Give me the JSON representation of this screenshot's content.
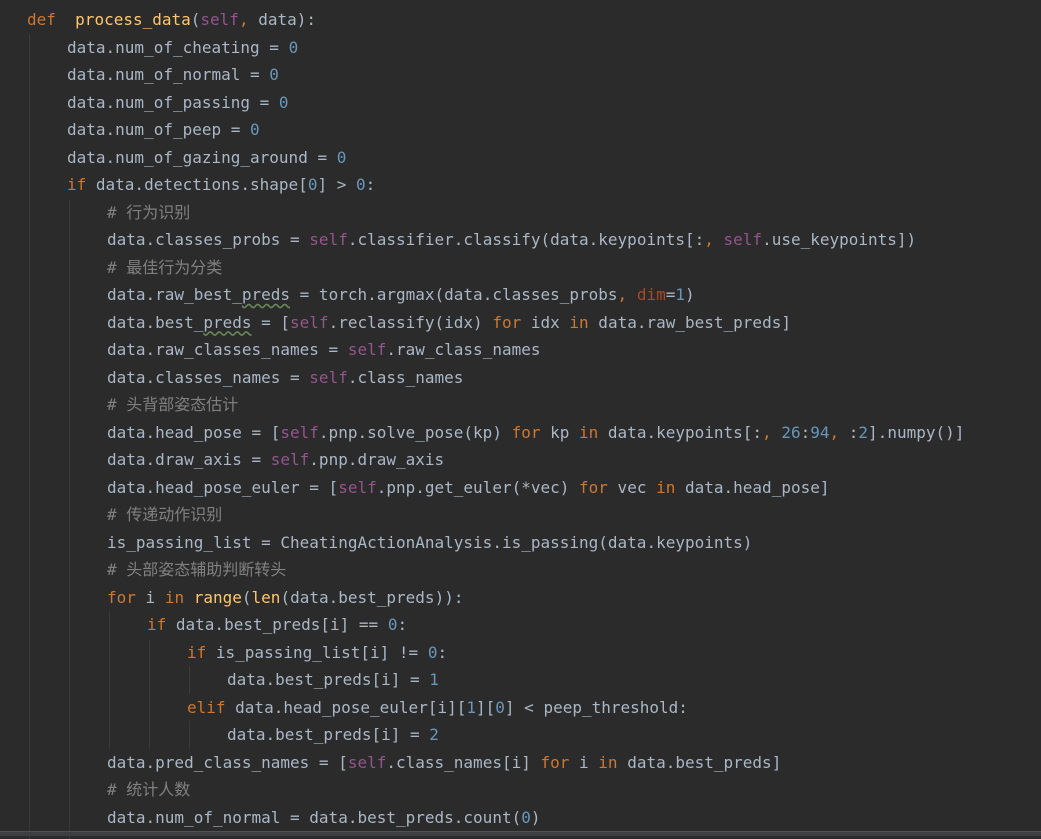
{
  "colors": {
    "background": "#2b2b2b",
    "default": "#a9b7c6",
    "keyword": "#cc7832",
    "function_name": "#ffc66d",
    "self": "#94558d",
    "number": "#6897bb",
    "comment": "#808080",
    "named_arg": "#aa4926"
  },
  "code_lines": [
    {
      "indent": 0,
      "tokens": [
        [
          "kw",
          "def"
        ],
        [
          "",
          "  "
        ],
        [
          "fn",
          "process_data"
        ],
        [
          "",
          "("
        ],
        [
          "self",
          "self"
        ],
        [
          "kw",
          ","
        ],
        [
          "",
          " data):"
        ]
      ]
    },
    {
      "indent": 1,
      "tokens": [
        [
          "",
          "data.num_of_cheating = "
        ],
        [
          "num",
          "0"
        ]
      ]
    },
    {
      "indent": 1,
      "tokens": [
        [
          "",
          "data.num_of_normal = "
        ],
        [
          "num",
          "0"
        ]
      ]
    },
    {
      "indent": 1,
      "tokens": [
        [
          "",
          "data.num_of_passing = "
        ],
        [
          "num",
          "0"
        ]
      ]
    },
    {
      "indent": 1,
      "tokens": [
        [
          "",
          "data.num_of_peep = "
        ],
        [
          "num",
          "0"
        ]
      ]
    },
    {
      "indent": 1,
      "tokens": [
        [
          "",
          "data.num_of_gazing_around = "
        ],
        [
          "num",
          "0"
        ]
      ]
    },
    {
      "indent": 1,
      "tokens": [
        [
          "kw",
          "if"
        ],
        [
          "",
          " data.detections.shape["
        ],
        [
          "num",
          "0"
        ],
        [
          "",
          "] > "
        ],
        [
          "num",
          "0"
        ],
        [
          "",
          ":"
        ]
      ]
    },
    {
      "indent": 2,
      "tokens": [
        [
          "cm",
          "# 行为识别"
        ]
      ]
    },
    {
      "indent": 2,
      "tokens": [
        [
          "",
          "data.classes_probs = "
        ],
        [
          "self",
          "self"
        ],
        [
          "",
          ".classifier.classify(data.keypoints[:"
        ],
        [
          "kw",
          ","
        ],
        [
          " ",
          ""
        ],
        [
          "self",
          " self"
        ],
        [
          "",
          ".use_keypoints])"
        ]
      ]
    },
    {
      "indent": 2,
      "tokens": [
        [
          "cm",
          "# 最佳行为分类"
        ]
      ]
    },
    {
      "indent": 2,
      "tokens": [
        [
          "",
          "data.raw_best_"
        ],
        [
          "typo",
          "preds"
        ],
        [
          "",
          " = torch.argmax(data.classes_probs"
        ],
        [
          "kw",
          ","
        ],
        [
          "named",
          " dim"
        ],
        [
          "",
          "="
        ],
        [
          "num",
          "1"
        ],
        [
          "",
          ")"
        ]
      ]
    },
    {
      "indent": 2,
      "tokens": [
        [
          "",
          "data.best_"
        ],
        [
          "typo",
          "preds"
        ],
        [
          "",
          " = ["
        ],
        [
          "self",
          "self"
        ],
        [
          "",
          ".reclassify(idx) "
        ],
        [
          "kw",
          "for"
        ],
        [
          "",
          " idx "
        ],
        [
          "kw",
          "in"
        ],
        [
          "",
          " data.raw_best_preds]"
        ]
      ]
    },
    {
      "indent": 2,
      "tokens": [
        [
          "",
          "data.raw_classes_names = "
        ],
        [
          "self",
          "self"
        ],
        [
          "",
          ".raw_class_names"
        ]
      ]
    },
    {
      "indent": 2,
      "tokens": [
        [
          "",
          "data.classes_names = "
        ],
        [
          "self",
          "self"
        ],
        [
          "",
          ".class_names"
        ]
      ]
    },
    {
      "indent": 2,
      "tokens": [
        [
          "cm",
          "# 头背部姿态估计"
        ]
      ]
    },
    {
      "indent": 2,
      "tokens": [
        [
          "",
          "data.head_pose = ["
        ],
        [
          "self",
          "self"
        ],
        [
          "",
          ".pnp.solve_pose(kp) "
        ],
        [
          "kw",
          "for"
        ],
        [
          "",
          " kp "
        ],
        [
          "kw",
          "in"
        ],
        [
          "",
          " data.keypoints[:"
        ],
        [
          "kw",
          ","
        ],
        [
          "",
          " "
        ],
        [
          "num",
          "26"
        ],
        [
          "",
          ":"
        ],
        [
          "num",
          "94"
        ],
        [
          "kw",
          ","
        ],
        [
          "",
          " :"
        ],
        [
          "num",
          "2"
        ],
        [
          "",
          "].numpy()]"
        ]
      ]
    },
    {
      "indent": 2,
      "tokens": [
        [
          "",
          "data.draw_axis = "
        ],
        [
          "self",
          "self"
        ],
        [
          "",
          ".pnp.draw_axis"
        ]
      ]
    },
    {
      "indent": 2,
      "tokens": [
        [
          "",
          "data.head_pose_euler = ["
        ],
        [
          "self",
          "self"
        ],
        [
          "",
          ".pnp.get_euler(*vec) "
        ],
        [
          "kw",
          "for"
        ],
        [
          "",
          " vec "
        ],
        [
          "kw",
          "in"
        ],
        [
          "",
          " data.head_pose]"
        ]
      ]
    },
    {
      "indent": 2,
      "tokens": [
        [
          "cm",
          "# 传递动作识别"
        ]
      ]
    },
    {
      "indent": 2,
      "tokens": [
        [
          "",
          "is_passing_list = CheatingActionAnalysis.is_passing(data.keypoints)"
        ]
      ]
    },
    {
      "indent": 2,
      "tokens": [
        [
          "cm",
          "# 头部姿态辅助判断转头"
        ]
      ]
    },
    {
      "indent": 2,
      "tokens": [
        [
          "kw",
          "for"
        ],
        [
          "",
          " i "
        ],
        [
          "kw",
          "in"
        ],
        [
          "",
          " "
        ],
        [
          "fn",
          "range"
        ],
        [
          "",
          "("
        ],
        [
          "fn",
          "len"
        ],
        [
          "",
          "(data.best_preds)):"
        ]
      ]
    },
    {
      "indent": 3,
      "tokens": [
        [
          "kw",
          "if"
        ],
        [
          "",
          " data.best_preds[i] == "
        ],
        [
          "num",
          "0"
        ],
        [
          "",
          ":"
        ]
      ]
    },
    {
      "indent": 4,
      "tokens": [
        [
          "kw",
          "if"
        ],
        [
          "",
          " is_passing_list[i] != "
        ],
        [
          "num",
          "0"
        ],
        [
          "",
          ":"
        ]
      ]
    },
    {
      "indent": 5,
      "tokens": [
        [
          "",
          "data.best_preds[i] = "
        ],
        [
          "num",
          "1"
        ]
      ]
    },
    {
      "indent": 4,
      "tokens": [
        [
          "kw",
          "elif"
        ],
        [
          "",
          " data.head_pose_euler[i]["
        ],
        [
          "num",
          "1"
        ],
        [
          "",
          "]["
        ],
        [
          "num",
          "0"
        ],
        [
          "",
          "] < peep_threshold:"
        ]
      ]
    },
    {
      "indent": 5,
      "tokens": [
        [
          "",
          "data.best_preds[i] = "
        ],
        [
          "num",
          "2"
        ]
      ]
    },
    {
      "indent": 2,
      "tokens": [
        [
          "",
          "data.pred_class_names = ["
        ],
        [
          "self",
          "self"
        ],
        [
          "",
          ".class_names[i] "
        ],
        [
          "kw",
          "for"
        ],
        [
          "",
          " i "
        ],
        [
          "kw",
          "in"
        ],
        [
          "",
          " data.best_preds]"
        ]
      ]
    },
    {
      "indent": 2,
      "tokens": [
        [
          "cm",
          "# 统计人数"
        ]
      ]
    },
    {
      "indent": 2,
      "tokens": [
        [
          "",
          "data.num_of_normal = data.best_preds.count("
        ],
        [
          "num",
          "0"
        ],
        [
          "",
          ")"
        ]
      ]
    }
  ]
}
